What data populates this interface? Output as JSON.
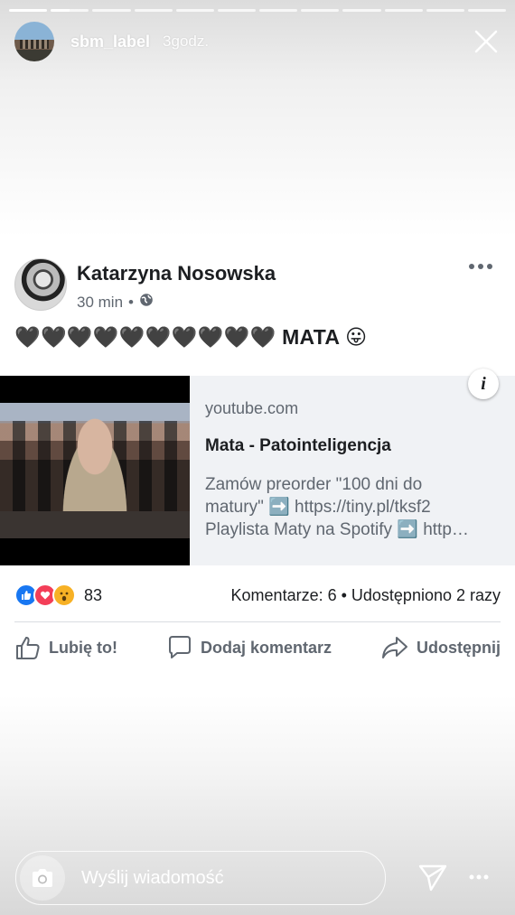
{
  "story": {
    "username": "sbm_label",
    "time": "3godz.",
    "progress": {
      "segments": 12,
      "completed": 1,
      "current_fraction": 0.5
    }
  },
  "post": {
    "author": "Katarzyna Nosowska",
    "timestamp": "30 min",
    "separator": "•",
    "privacy_icon": "globe-icon",
    "text": "🖤🖤🖤🖤🖤🖤🖤🖤🖤🖤 MATA 😛",
    "link": {
      "domain": "youtube.com",
      "title": "Mata - Patointeligencja",
      "desc_line1": "Zamów preorder \"100 dni do",
      "desc_line2": "matury\" ➡️ https://tiny.pl/tksf2",
      "desc_line3": "Playlista Maty na Spotify ➡️ http…",
      "info_label": "i"
    },
    "reactions": {
      "icons": [
        "like-icon",
        "love-icon",
        "wow-icon"
      ],
      "count": "83",
      "stats": "Komentarze: 6 • Udostępniono 2 razy"
    },
    "actions": {
      "like": "Lubię to!",
      "comment": "Dodaj komentarz",
      "share": "Udostępnij"
    }
  },
  "footer": {
    "message_placeholder": "Wyślij wiadomość"
  },
  "colors": {
    "fb_blue": "#1877f2",
    "love_red": "#f33e58",
    "wow_yellow": "#f7b125",
    "meta_gray": "#606770"
  }
}
